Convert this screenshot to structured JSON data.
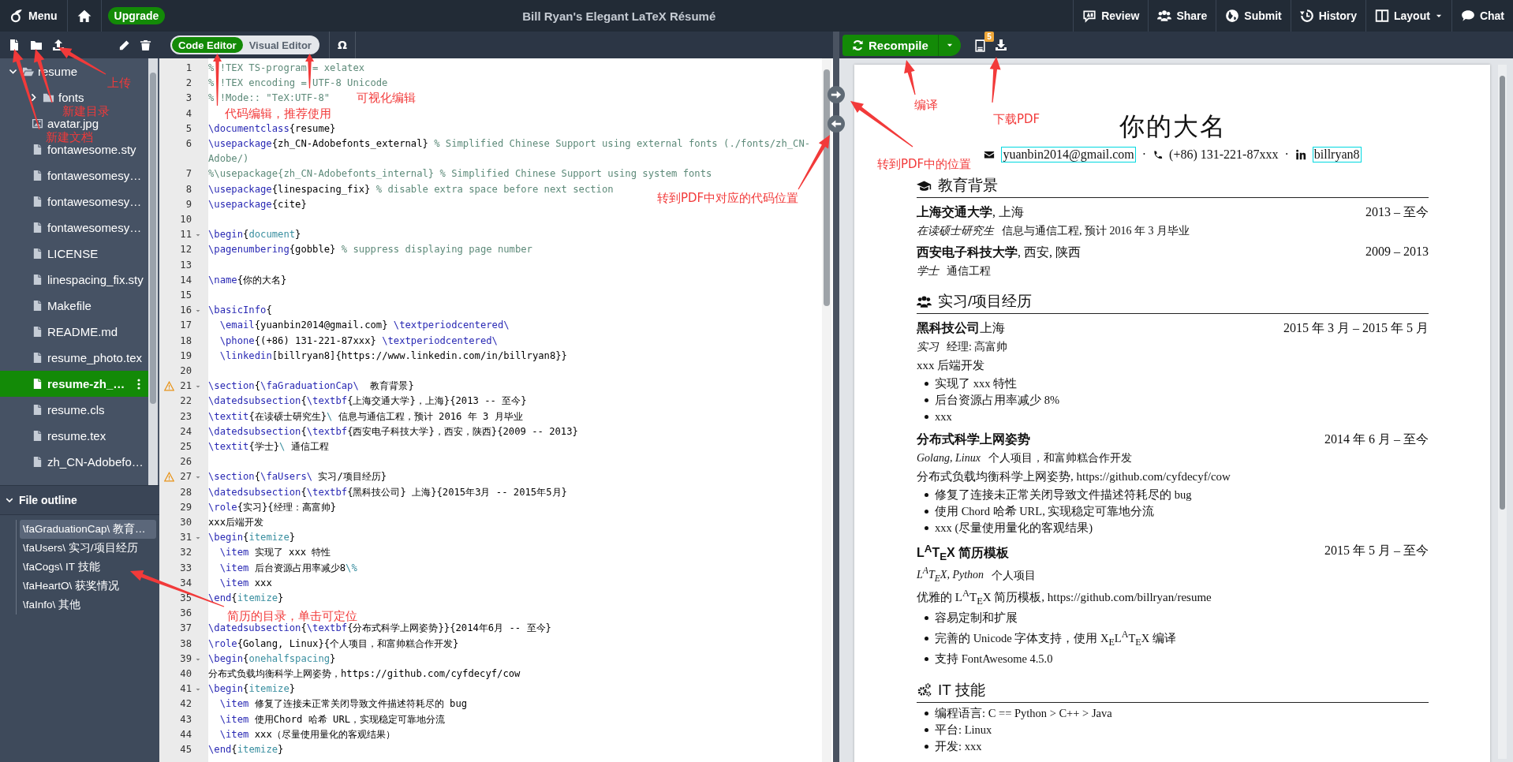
{
  "topbar": {
    "menu": "Menu",
    "upgrade": "Upgrade",
    "title": "Bill Ryan's Elegant LaTeX Résumé",
    "actions": [
      {
        "label": "Review",
        "dropdown": false
      },
      {
        "label": "Share",
        "dropdown": false
      },
      {
        "label": "Submit",
        "dropdown": false
      },
      {
        "label": "History",
        "dropdown": false
      },
      {
        "label": "Layout",
        "dropdown": true
      },
      {
        "label": "Chat",
        "dropdown": false
      }
    ]
  },
  "file_tree": [
    {
      "name": "resume",
      "kind": "folder",
      "expanded": true,
      "selected": false,
      "children": [
        {
          "name": "fonts",
          "kind": "folder",
          "expanded": false,
          "selected": false
        },
        {
          "name": "avatar.jpg",
          "kind": "image",
          "selected": false
        },
        {
          "name": "fontawesome.sty",
          "kind": "file",
          "selected": false
        },
        {
          "name": "fontawesomesy…",
          "kind": "file",
          "selected": false
        },
        {
          "name": "fontawesomesy…",
          "kind": "file",
          "selected": false
        },
        {
          "name": "fontawesomesy…",
          "kind": "file",
          "selected": false
        },
        {
          "name": "LICENSE",
          "kind": "file",
          "selected": false
        },
        {
          "name": "linespacing_fix.sty",
          "kind": "file",
          "selected": false
        },
        {
          "name": "Makefile",
          "kind": "file",
          "selected": false
        },
        {
          "name": "README.md",
          "kind": "file",
          "selected": false
        },
        {
          "name": "resume_photo.tex",
          "kind": "file",
          "selected": false
        },
        {
          "name": "resume-zh_…",
          "kind": "file",
          "selected": true
        },
        {
          "name": "resume.cls",
          "kind": "file",
          "selected": false
        },
        {
          "name": "resume.tex",
          "kind": "file",
          "selected": false
        },
        {
          "name": "zh_CN-Adobefo…",
          "kind": "file",
          "selected": false
        }
      ]
    }
  ],
  "file_outline": {
    "title": "File outline",
    "expanded": true,
    "items": [
      {
        "text": "\\faGraduationCap\\ 教育…",
        "selected": true
      },
      {
        "text": "\\faUsers\\ 实习/项目经历",
        "selected": false
      },
      {
        "text": "\\faCogs\\ IT 技能",
        "selected": false
      },
      {
        "text": "\\faHeartO\\ 获奖情况",
        "selected": false
      },
      {
        "text": "\\faInfo\\ 其他",
        "selected": false
      }
    ]
  },
  "editor": {
    "modes": [
      {
        "label": "Code Editor",
        "selected": true
      },
      {
        "label": "Visual Editor",
        "selected": false
      }
    ],
    "symbol": "Ω",
    "lines": [
      {
        "n": "1",
        "text": "% !TEX TS-program = xelatex",
        "fold": false,
        "warning": false
      },
      {
        "n": "2",
        "text": "% !TEX encoding = UTF-8 Unicode",
        "fold": false,
        "warning": false
      },
      {
        "n": "3",
        "text": "% !Mode:: \"TeX:UTF-8\"",
        "fold": false,
        "warning": false
      },
      {
        "n": "4",
        "fold": false,
        "warning": false
      },
      {
        "n": "5",
        "text": "\\documentclass{resume}",
        "fold": false,
        "warning": false
      },
      {
        "n": "6",
        "text": "\\usepackage{zh_CN-Adobefonts_external} % Simplified Chinese Support using external fonts (./fonts/zh_CN-Adobe/)",
        "fold": false,
        "warning": false
      },
      {
        "n": "7",
        "text": "%\\usepackage{zh_CN-Adobefonts_internal} % Simplified Chinese Support using system fonts",
        "fold": false,
        "warning": false
      },
      {
        "n": "8",
        "text": "\\usepackage{linespacing_fix} % disable extra space before next section",
        "fold": false,
        "warning": false
      },
      {
        "n": "9",
        "text": "\\usepackage{cite}",
        "fold": false,
        "warning": false
      },
      {
        "n": "10",
        "fold": false,
        "warning": false
      },
      {
        "n": "11",
        "text": "\\begin{document}",
        "fold": true,
        "warning": false
      },
      {
        "n": "12",
        "text": "\\pagenumbering{gobble} % suppress displaying page number",
        "fold": false,
        "warning": false
      },
      {
        "n": "13",
        "fold": false,
        "warning": false
      },
      {
        "n": "14",
        "text": "\\name{你的大名}",
        "fold": false,
        "warning": false
      },
      {
        "n": "15",
        "fold": false,
        "warning": false
      },
      {
        "n": "16",
        "text": "\\basicInfo{",
        "fold": true,
        "warning": false
      },
      {
        "n": "17",
        "text": "  \\email{yuanbin2014@gmail.com} \\textperiodcentered\\",
        "fold": false,
        "warning": false
      },
      {
        "n": "18",
        "text": "  \\phone{(+86) 131-221-87xxx} \\textperiodcentered\\",
        "fold": false,
        "warning": false
      },
      {
        "n": "19",
        "text": "  \\linkedin[billryan8]{https://www.linkedin.com/in/billryan8}}",
        "fold": false,
        "warning": false
      },
      {
        "n": "20",
        "fold": false,
        "warning": false
      },
      {
        "n": "21",
        "text": "\\section{\\faGraduationCap\\  教育背景}",
        "fold": true,
        "warning": true
      },
      {
        "n": "22",
        "text": "\\datedsubsection{\\textbf{上海交通大学}，上海}{2013 -- 至今}",
        "fold": false,
        "warning": false
      },
      {
        "n": "23",
        "text": "\\textit{在读硕士研究生}\\ 信息与通信工程，预计 2016 年 3 月毕业",
        "fold": false,
        "warning": false
      },
      {
        "n": "24",
        "text": "\\datedsubsection{\\textbf{西安电子科技大学}，西安，陕西}{2009 -- 2013}",
        "fold": false,
        "warning": false
      },
      {
        "n": "25",
        "text": "\\textit{学士}\\ 通信工程",
        "fold": false,
        "warning": false
      },
      {
        "n": "26",
        "fold": false,
        "warning": false
      },
      {
        "n": "27",
        "text": "\\section{\\faUsers\\ 实习/项目经历}",
        "fold": true,
        "warning": true
      },
      {
        "n": "28",
        "text": "\\datedsubsection{\\textbf{黑科技公司} 上海}{2015年3月 -- 2015年5月}",
        "fold": false,
        "warning": false
      },
      {
        "n": "29",
        "text": "\\role{实习}{经理：高富帅}",
        "fold": false,
        "warning": false
      },
      {
        "n": "30",
        "text": "xxx后端开发",
        "fold": false,
        "warning": false
      },
      {
        "n": "31",
        "text": "\\begin{itemize}",
        "fold": true,
        "warning": false
      },
      {
        "n": "32",
        "text": "  \\item 实现了 xxx 特性",
        "fold": false,
        "warning": false
      },
      {
        "n": "33",
        "text": "  \\item 后台资源占用率减少8\\%",
        "fold": false,
        "warning": false
      },
      {
        "n": "34",
        "text": "  \\item xxx",
        "fold": false,
        "warning": false
      },
      {
        "n": "35",
        "text": "\\end{itemize}",
        "fold": false,
        "warning": false
      },
      {
        "n": "36",
        "fold": false,
        "warning": false
      },
      {
        "n": "37",
        "text": "\\datedsubsection{\\textbf{分布式科学上网姿势}}{2014年6月 -- 至今}",
        "fold": false,
        "warning": false
      },
      {
        "n": "38",
        "text": "\\role{Golang, Linux}{个人项目，和富帅糕合作开发}",
        "fold": false,
        "warning": false
      },
      {
        "n": "39",
        "text": "\\begin{onehalfspacing}",
        "fold": true,
        "warning": false
      },
      {
        "n": "40",
        "text": "分布式负载均衡科学上网姿势，https://github.com/cyfdecyf/cow",
        "fold": false,
        "warning": false
      },
      {
        "n": "41",
        "text": "\\begin{itemize}",
        "fold": true,
        "warning": false
      },
      {
        "n": "42",
        "text": "  \\item 修复了连接未正常关闭导致文件描述符耗尽的 bug",
        "fold": false,
        "warning": false
      },
      {
        "n": "43",
        "text": "  \\item 使用Chord 哈希 URL，实现稳定可靠地分流",
        "fold": false,
        "warning": false
      },
      {
        "n": "44",
        "text": "  \\item xxx（尽量使用量化的客观结果）",
        "fold": false,
        "warning": false
      },
      {
        "n": "45",
        "text": "\\end{itemize}",
        "fold": false,
        "warning": false
      }
    ]
  },
  "pdf_toolbar": {
    "recompile": "Recompile",
    "log_count": "5"
  },
  "resume": {
    "name": "你的大名",
    "contacts": [
      {
        "kind": "email",
        "text": "yuanbin2014@gmail.com"
      },
      {
        "kind": "separator",
        "text": "·"
      },
      {
        "kind": "phone",
        "text": "(+86) 131-221-87xxx"
      },
      {
        "kind": "separator",
        "text": "·"
      },
      {
        "kind": "linkedin",
        "text": "billryan8"
      }
    ],
    "sections": [
      {
        "title": "教育背景",
        "entries": [
          {
            "title": "上海交通大学",
            "location": ", 上海",
            "date": "2013 – 至今",
            "role_tags": "在读硕士研究生",
            "role": "信息与通信工程, 预计 2016 年 3 月毕业"
          },
          {
            "title": "西安电子科技大学",
            "location": ", 西安, 陕西",
            "date": "2009 – 2013",
            "role_tags": "学士",
            "role": "通信工程"
          }
        ]
      },
      {
        "title": "实习/项目经历",
        "entries": [
          {
            "title": "黑科技公司",
            "location": "上海",
            "date": "2015 年 3 月 – 2015 年 5 月",
            "role_tags": "实习",
            "role": "经理: 高富帅",
            "text": "xxx 后端开发",
            "bullets": [
              "实现了 xxx 特性",
              "后台资源占用率减少 8%",
              "xxx"
            ]
          },
          {
            "title": "分布式科学上网姿势",
            "date": "2014 年 6 月 – 至今",
            "role_tags": "Golang, Linux",
            "role": "个人项目，和富帅糕合作开发",
            "text": "分布式负载均衡科学上网姿势, https://github.com/cyfdecyf/cow",
            "bullets": [
              "修复了连接未正常关闭导致文件描述符耗尽的 bug",
              "使用 Chord 哈希 URL, 实现稳定可靠地分流",
              "xxx (尽量使用量化的客观结果)"
            ]
          },
          {
            "title": "L$^{A}$T$_{E}$X 简历模板",
            "date": "2015 年 5 月 – 至今",
            "role_tags": "L$^{A}$T$_{E}$X, Python",
            "role": "个人项目",
            "text": "优雅的 L$^{A}$T$_{E}$X 简历模板, https://github.com/billryan/resume",
            "bullets": [
              "容易定制和扩展",
              "完善的 Unicode 字体支持，使用 X$_{E}$L$^{A}$T$_{E}$X 编译",
              "支持 FontAwesome 4.5.0"
            ]
          }
        ]
      },
      {
        "title": "IT 技能",
        "bullets": [
          "编程语言: C == Python > C++ > Java",
          "平台: Linux",
          "开发: xxx"
        ]
      }
    ]
  },
  "annotations": [
    {
      "text": "上传"
    },
    {
      "text": "新建目录"
    },
    {
      "text": "新建文档"
    },
    {
      "text": "代码编辑，推荐使用"
    },
    {
      "text": "可视化编辑"
    },
    {
      "text": "转到PDF中对应的代码位置"
    },
    {
      "text": "编译"
    },
    {
      "text": "下载PDF"
    },
    {
      "text": "转到PDF中的位置"
    },
    {
      "text": "简历的目录，单击可定位"
    }
  ]
}
